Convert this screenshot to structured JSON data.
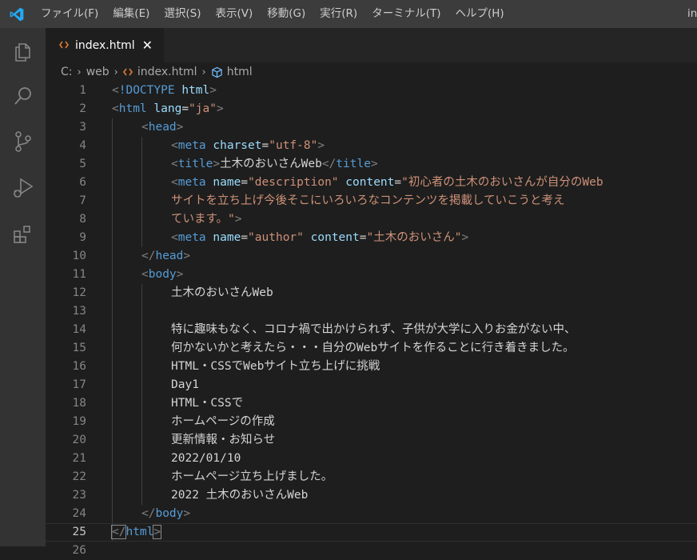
{
  "menu": {
    "items": [
      "ファイル(F)",
      "編集(E)",
      "選択(S)",
      "表示(V)",
      "移動(G)",
      "実行(R)",
      "ターミナル(T)",
      "ヘルプ(H)"
    ],
    "window_title": "in"
  },
  "activity_icons": [
    "explorer-icon",
    "search-icon",
    "source-control-icon",
    "run-debug-icon",
    "extensions-icon"
  ],
  "tab": {
    "label": "index.html",
    "close_glyph": "✕",
    "icon": "html-file-icon"
  },
  "breadcrumb": {
    "drive": "C:",
    "folder": "web",
    "file": "index.html",
    "symbol": "html",
    "separator": "›"
  },
  "editor": {
    "active_line": 25,
    "lines": [
      {
        "n": "1",
        "indent": 0,
        "tokens": [
          [
            "t-punc",
            "<"
          ],
          [
            "t-tag",
            "!DOCTYPE"
          ],
          [
            "t-text",
            " "
          ],
          [
            "t-attr",
            "html"
          ],
          [
            "t-punc",
            ">"
          ]
        ]
      },
      {
        "n": "2",
        "indent": 0,
        "tokens": [
          [
            "t-punc",
            "<"
          ],
          [
            "t-tag",
            "html"
          ],
          [
            "t-text",
            " "
          ],
          [
            "t-attr",
            "lang"
          ],
          [
            "t-text",
            "="
          ],
          [
            "t-str",
            "\"ja\""
          ],
          [
            "t-punc",
            ">"
          ]
        ]
      },
      {
        "n": "3",
        "indent": 1,
        "tokens": [
          [
            "t-punc",
            "<"
          ],
          [
            "t-tag",
            "head"
          ],
          [
            "t-punc",
            ">"
          ]
        ]
      },
      {
        "n": "4",
        "indent": 2,
        "tokens": [
          [
            "t-punc",
            "<"
          ],
          [
            "t-tag",
            "meta"
          ],
          [
            "t-text",
            " "
          ],
          [
            "t-attr",
            "charset"
          ],
          [
            "t-text",
            "="
          ],
          [
            "t-str",
            "\"utf-8\""
          ],
          [
            "t-punc",
            ">"
          ]
        ]
      },
      {
        "n": "5",
        "indent": 2,
        "tokens": [
          [
            "t-punc",
            "<"
          ],
          [
            "t-tag",
            "title"
          ],
          [
            "t-punc",
            ">"
          ],
          [
            "t-text",
            "土木のおいさんWeb"
          ],
          [
            "t-punc",
            "</"
          ],
          [
            "t-tag",
            "title"
          ],
          [
            "t-punc",
            ">"
          ]
        ]
      },
      {
        "n": "6",
        "indent": 2,
        "tokens": [
          [
            "t-punc",
            "<"
          ],
          [
            "t-tag",
            "meta"
          ],
          [
            "t-text",
            " "
          ],
          [
            "t-attr",
            "name"
          ],
          [
            "t-text",
            "="
          ],
          [
            "t-str",
            "\"description\""
          ],
          [
            "t-text",
            " "
          ],
          [
            "t-attr",
            "content"
          ],
          [
            "t-text",
            "="
          ],
          [
            "t-str",
            "\"初心者の土木のおいさんが自分のWeb"
          ]
        ]
      },
      {
        "n": "7",
        "indent": 2,
        "tokens": [
          [
            "t-str",
            "サイトを立ち上げ今後そこにいろいろなコンテンツを掲載していこうと考え"
          ]
        ]
      },
      {
        "n": "8",
        "indent": 2,
        "tokens": [
          [
            "t-str",
            "ています。\""
          ],
          [
            "t-punc",
            ">"
          ]
        ]
      },
      {
        "n": "9",
        "indent": 2,
        "tokens": [
          [
            "t-punc",
            "<"
          ],
          [
            "t-tag",
            "meta"
          ],
          [
            "t-text",
            " "
          ],
          [
            "t-attr",
            "name"
          ],
          [
            "t-text",
            "="
          ],
          [
            "t-str",
            "\"author\""
          ],
          [
            "t-text",
            " "
          ],
          [
            "t-attr",
            "content"
          ],
          [
            "t-text",
            "="
          ],
          [
            "t-str",
            "\"土木のおいさん\""
          ],
          [
            "t-punc",
            ">"
          ]
        ]
      },
      {
        "n": "10",
        "indent": 1,
        "tokens": [
          [
            "t-punc",
            "</"
          ],
          [
            "t-tag",
            "head"
          ],
          [
            "t-punc",
            ">"
          ]
        ]
      },
      {
        "n": "11",
        "indent": 1,
        "tokens": [
          [
            "t-punc",
            "<"
          ],
          [
            "t-tag",
            "body"
          ],
          [
            "t-punc",
            ">"
          ]
        ]
      },
      {
        "n": "12",
        "indent": 2,
        "tokens": [
          [
            "t-text",
            "土木のおいさんWeb"
          ]
        ]
      },
      {
        "n": "13",
        "indent": 2,
        "tokens": []
      },
      {
        "n": "14",
        "indent": 2,
        "tokens": [
          [
            "t-text",
            "特に趣味もなく、コロナ禍で出かけられず、子供が大学に入りお金がない中、"
          ]
        ]
      },
      {
        "n": "15",
        "indent": 2,
        "tokens": [
          [
            "t-text",
            "何かないかと考えたら・・・自分のWebサイトを作ることに行き着きました。"
          ]
        ]
      },
      {
        "n": "16",
        "indent": 2,
        "tokens": [
          [
            "t-text",
            "HTML・CSSでWebサイト立ち上げに挑戦"
          ]
        ]
      },
      {
        "n": "17",
        "indent": 2,
        "tokens": [
          [
            "t-text",
            "Day1"
          ]
        ]
      },
      {
        "n": "18",
        "indent": 2,
        "tokens": [
          [
            "t-text",
            "HTML・CSSで"
          ]
        ]
      },
      {
        "n": "19",
        "indent": 2,
        "tokens": [
          [
            "t-text",
            "ホームページの作成"
          ]
        ]
      },
      {
        "n": "20",
        "indent": 2,
        "tokens": [
          [
            "t-text",
            "更新情報・お知らせ"
          ]
        ]
      },
      {
        "n": "21",
        "indent": 2,
        "tokens": [
          [
            "t-text",
            "2022/01/10"
          ]
        ]
      },
      {
        "n": "22",
        "indent": 2,
        "tokens": [
          [
            "t-text",
            "ホームページ立ち上げました。"
          ]
        ]
      },
      {
        "n": "23",
        "indent": 2,
        "tokens": [
          [
            "t-text",
            "2022 土木のおいさんWeb"
          ]
        ]
      },
      {
        "n": "24",
        "indent": 1,
        "tokens": [
          [
            "t-punc",
            "</"
          ],
          [
            "t-tag",
            "body"
          ],
          [
            "t-punc",
            ">"
          ]
        ]
      },
      {
        "n": "25",
        "indent": 0,
        "tokens": [
          [
            "t-punc",
            "</"
          ],
          [
            "t-tag",
            "html"
          ],
          [
            "t-punc",
            ">"
          ]
        ]
      },
      {
        "n": "26",
        "indent": 0,
        "tokens": []
      }
    ]
  },
  "colors": {
    "background": "#1e1e1e",
    "titlebar": "#3c3c3c",
    "activitybar": "#333333",
    "tag": "#569cd6",
    "attribute": "#9cdcfe",
    "string": "#ce9178",
    "text": "#d4d4d4",
    "line_number": "#858585",
    "vscode_blue": "#23a9f2",
    "html_icon": "#e37933"
  }
}
